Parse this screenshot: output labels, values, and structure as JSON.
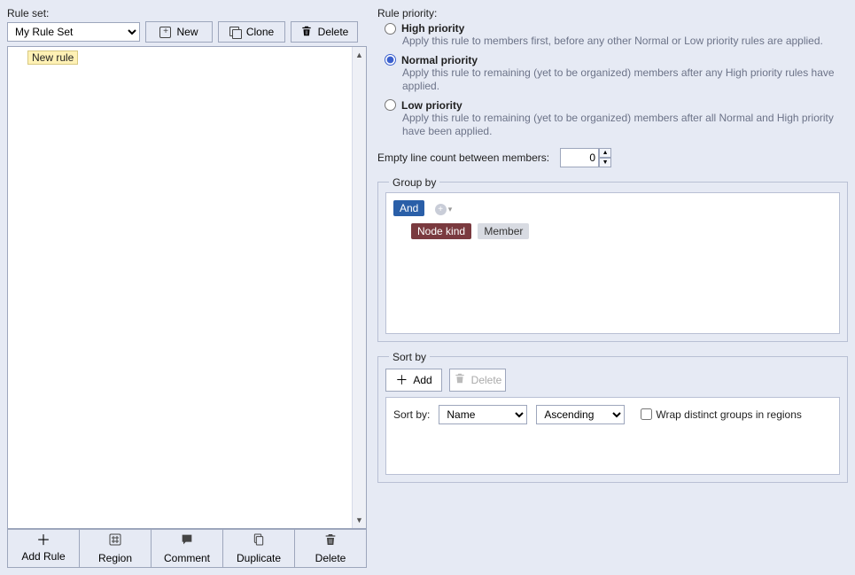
{
  "left": {
    "rule_set_label": "Rule set:",
    "selected_set": "My Rule Set",
    "buttons": {
      "new": "New",
      "clone": "Clone",
      "delete": "Delete"
    },
    "items": [
      "New rule"
    ],
    "bottom": {
      "add_rule": "Add Rule",
      "region": "Region",
      "comment": "Comment",
      "duplicate": "Duplicate",
      "delete": "Delete"
    }
  },
  "right": {
    "priority_label": "Rule priority:",
    "priorities": [
      {
        "label": "High priority",
        "desc": "Apply this rule to members first, before any other Normal or Low priority rules are applied."
      },
      {
        "label": "Normal priority",
        "desc": "Apply this rule to remaining (yet to be organized) members after any High priority rules have applied."
      },
      {
        "label": "Low priority",
        "desc": "Apply this rule to remaining (yet to be organized) members after all Normal and High priority have been applied."
      }
    ],
    "selected_priority": "Normal priority",
    "empty_line_label": "Empty line count between members:",
    "empty_line_value": "0",
    "group_by": {
      "legend": "Group by",
      "op": "And",
      "chips": {
        "node_kind": "Node kind",
        "member": "Member"
      }
    },
    "sort_by": {
      "legend": "Sort by",
      "add": "Add",
      "delete": "Delete",
      "row_label": "Sort by:",
      "field": "Name",
      "direction": "Ascending",
      "wrap": "Wrap distinct groups in regions"
    }
  }
}
